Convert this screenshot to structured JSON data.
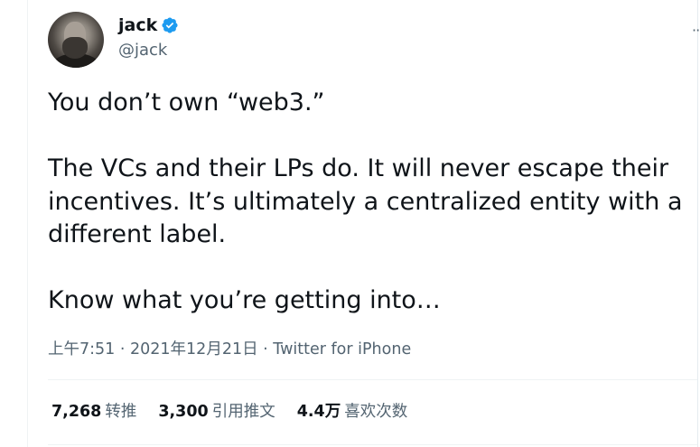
{
  "author": {
    "display_name": "jack",
    "handle": "@jack",
    "verified": true
  },
  "more_menu": "···",
  "tweet": {
    "text": "You don’t own “web3.”\n\nThe VCs and their LPs do. It will never escape their\nincentives. It’s ultimately a centralized entity with a\ndifferent label.\n\nKnow what you’re getting into…"
  },
  "meta": {
    "time": "上午7:51",
    "separator1": " · ",
    "date": "2021年12月21日",
    "separator2": " · ",
    "source": "Twitter for iPhone"
  },
  "stats": [
    {
      "count": "7,268",
      "label": "转推"
    },
    {
      "count": "3,300",
      "label": "引用推文"
    },
    {
      "count": "4.4万",
      "label": "喜欢次数"
    }
  ],
  "colors": {
    "text": "#0f1419",
    "secondary": "#536471",
    "verified": "#1d9bf0",
    "divider": "#eff3f4"
  },
  "icons": {
    "verified": "verified-badge-icon"
  }
}
